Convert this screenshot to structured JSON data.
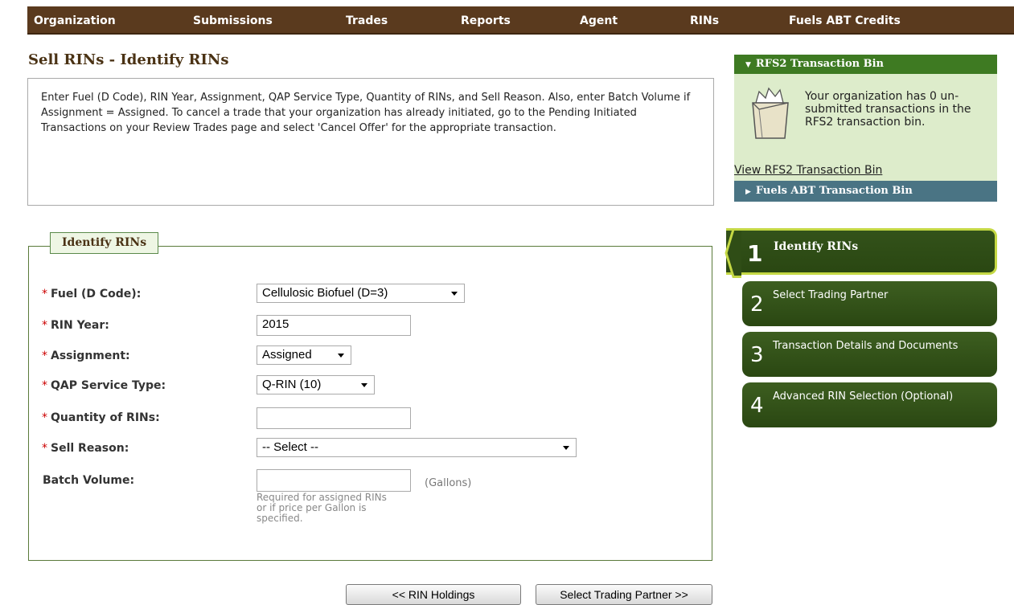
{
  "nav": {
    "items": [
      "Organization",
      "Submissions",
      "Trades",
      "Reports",
      "Agent",
      "RINs",
      "Fuels ABT Credits"
    ]
  },
  "page_title": "Sell RINs - Identify RINs",
  "instructions": "Enter Fuel (D Code), RIN Year, Assignment, QAP Service Type, Quantity of RINs, and Sell Reason. Also, enter Batch Volume if Assignment = Assigned. To cancel a trade that your organization has already initiated, go to the Pending Initiated Transactions on your Review Trades page and select 'Cancel Offer' for the appropriate transaction.",
  "form": {
    "legend": "Identify RINs",
    "required_marker": "*",
    "fuel": {
      "label": "Fuel (D Code):",
      "value": "Cellulosic Biofuel (D=3)"
    },
    "rin_year": {
      "label": "RIN Year:",
      "value": "2015"
    },
    "assignment": {
      "label": "Assignment:",
      "value": "Assigned"
    },
    "qap": {
      "label": "QAP Service Type:",
      "value": "Q-RIN (10)"
    },
    "quantity": {
      "label": "Quantity of RINs:",
      "value": ""
    },
    "sell_reason": {
      "label": "Sell Reason:",
      "value": "-- Select --"
    },
    "batch_volume": {
      "label": "Batch Volume:",
      "value": "",
      "unit": "(Gallons)",
      "hint": "Required for assigned RINs or if price per Gallon is specified."
    }
  },
  "buttons": {
    "back": "<< RIN Holdings",
    "next": "Select Trading Partner >>"
  },
  "rfs2_bin": {
    "title": "RFS2 Transaction Bin",
    "message": "Your organization has 0 un-submitted transactions in the RFS2 transaction bin.",
    "link": "View RFS2 Transaction Bin"
  },
  "fuels_abt_bin": {
    "title": "Fuels ABT Transaction Bin"
  },
  "steps": [
    {
      "num": "1",
      "label": "Identify RINs"
    },
    {
      "num": "2",
      "label": "Select Trading Partner"
    },
    {
      "num": "3",
      "label": "Transaction Details and Documents"
    },
    {
      "num": "4",
      "label": "Advanced RIN Selection (Optional)"
    }
  ],
  "colors": {
    "nav_bg": "#5a3a1e",
    "bin_header": "#3e7a22",
    "bin_body": "#ddeccb",
    "abt_header": "#4a7484",
    "step_bg": "#2e4d16",
    "active_border": "#c4d844",
    "required": "#cc0000"
  }
}
